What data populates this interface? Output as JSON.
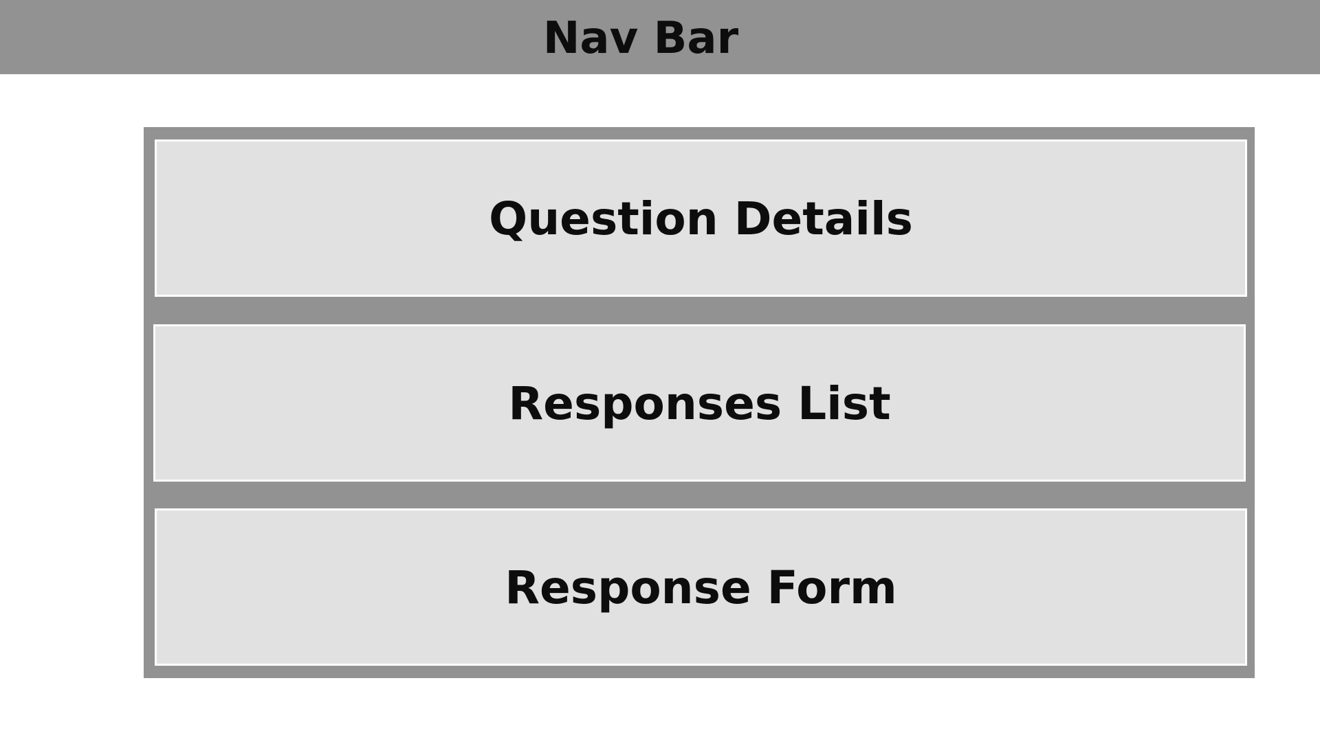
{
  "nav_bar": {
    "title": "Nav Bar"
  },
  "sections": {
    "question_details": "Question Details",
    "responses_list": "Responses List",
    "response_form": "Response Form"
  },
  "colors": {
    "frame": "#929292",
    "panel": "#e1e1e1",
    "text": "#0d0d0d",
    "background": "#ffffff"
  }
}
